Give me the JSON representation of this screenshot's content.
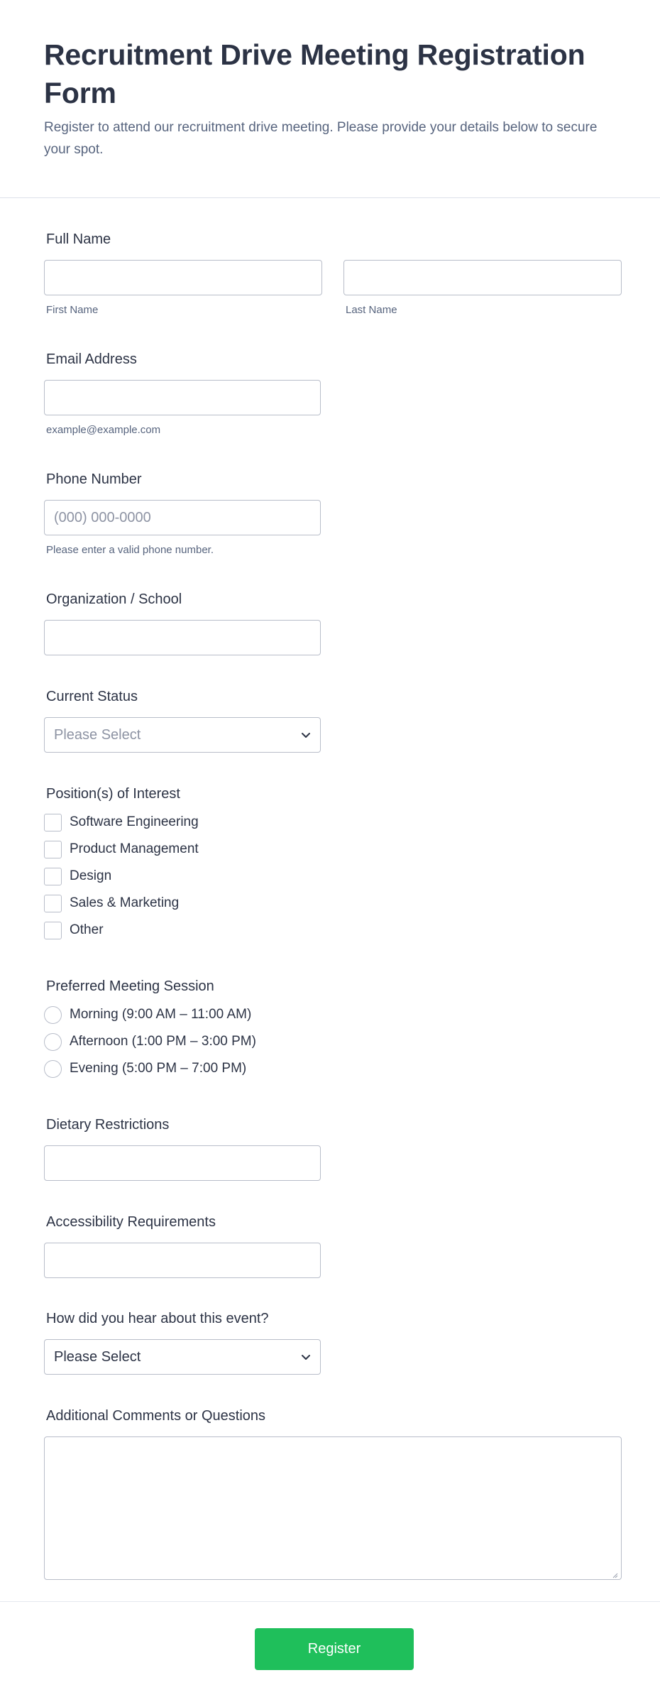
{
  "header": {
    "title": "Recruitment Drive Meeting Registration Form",
    "subtitle": "Register to attend our recruitment drive meeting. Please provide your details below to secure your spot."
  },
  "full_name": {
    "label": "Full Name",
    "first_sublabel": "First Name",
    "last_sublabel": "Last Name",
    "first_value": "",
    "last_value": ""
  },
  "email": {
    "label": "Email Address",
    "sublabel": "example@example.com",
    "value": ""
  },
  "phone": {
    "label": "Phone Number",
    "placeholder": "(000) 000-0000",
    "sublabel": "Please enter a valid phone number.",
    "value": ""
  },
  "organization": {
    "label": "Organization / School",
    "value": ""
  },
  "current_status": {
    "label": "Current Status",
    "selected": "Please Select"
  },
  "positions": {
    "label": "Position(s) of Interest",
    "options": [
      "Software Engineering",
      "Product Management",
      "Design",
      "Sales & Marketing",
      "Other"
    ]
  },
  "session": {
    "label": "Preferred Meeting Session",
    "options": [
      "Morning (9:00 AM – 11:00 AM)",
      "Afternoon (1:00 PM – 3:00 PM)",
      "Evening (5:00 PM – 7:00 PM)"
    ]
  },
  "dietary": {
    "label": "Dietary Restrictions",
    "value": ""
  },
  "accessibility": {
    "label": "Accessibility Requirements",
    "value": ""
  },
  "heard_about": {
    "label": "How did you hear about this event?",
    "selected": "Please Select"
  },
  "comments": {
    "label": "Additional Comments or Questions"
  },
  "submit": {
    "label": "Register"
  },
  "colors": {
    "submit_bg": "#1fbf5b",
    "text": "#2c3345",
    "border": "#b8bdc9"
  }
}
